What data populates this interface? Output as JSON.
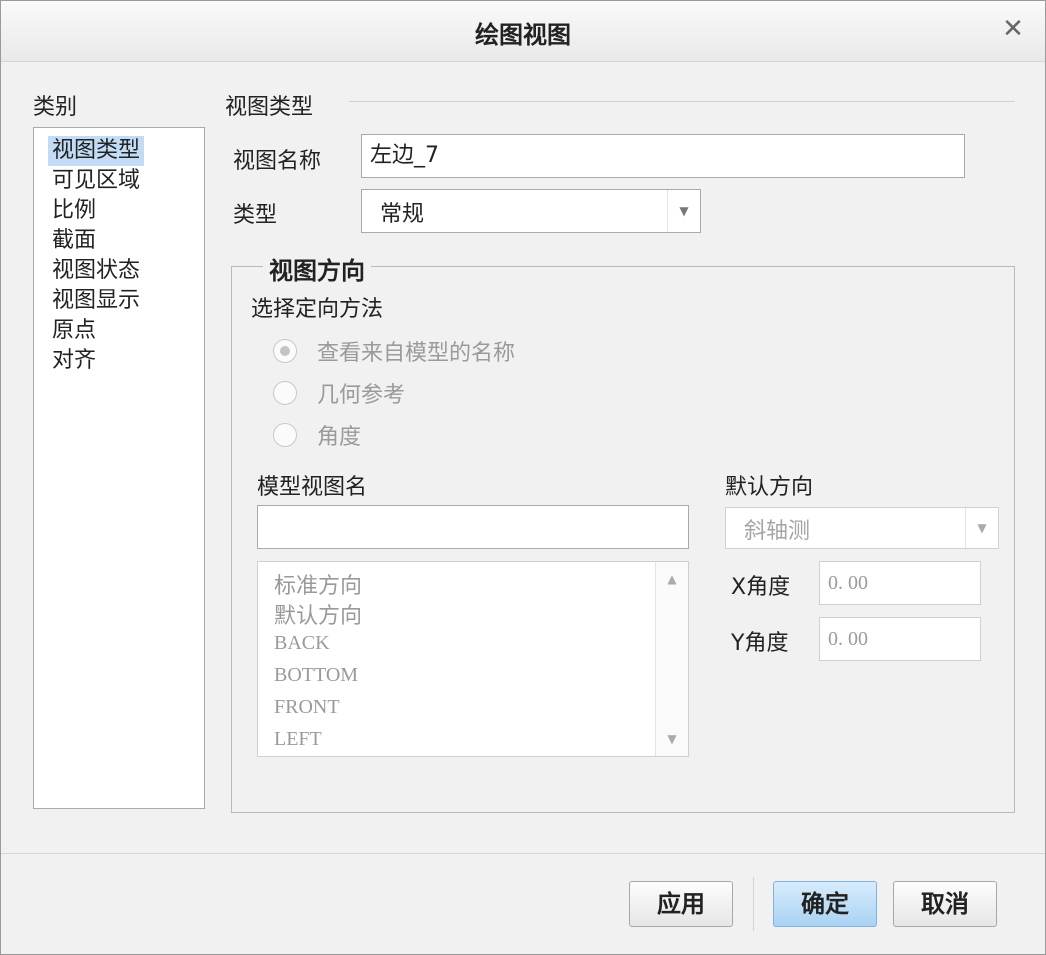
{
  "dialog": {
    "title": "绘图视图",
    "close_glyph": "✕"
  },
  "categories": {
    "heading": "类别",
    "items": [
      {
        "label": "视图类型",
        "selected": true
      },
      {
        "label": "可见区域",
        "selected": false
      },
      {
        "label": "比例",
        "selected": false
      },
      {
        "label": "截面",
        "selected": false
      },
      {
        "label": "视图状态",
        "selected": false
      },
      {
        "label": "视图显示",
        "selected": false
      },
      {
        "label": "原点",
        "selected": false
      },
      {
        "label": "对齐",
        "selected": false
      }
    ]
  },
  "view_type_section": {
    "heading": "视图类型",
    "view_name_label": "视图名称",
    "view_name_value": "左边_7",
    "type_label": "类型",
    "type_value": "常规"
  },
  "view_orientation": {
    "group_title": "视图方向",
    "method_label": "选择定向方法",
    "options": [
      {
        "label": "查看来自模型的名称",
        "checked": true
      },
      {
        "label": "几何参考",
        "checked": false
      },
      {
        "label": "角度",
        "checked": false
      }
    ],
    "model_view_name_label": "模型视图名",
    "model_view_name_value": "",
    "model_views": [
      "标准方向",
      "默认方向",
      "BACK",
      "BOTTOM",
      "FRONT",
      "LEFT"
    ],
    "default_orientation_label": "默认方向",
    "default_orientation_value": "斜轴测",
    "x_angle_label": "X角度",
    "x_angle_value": "0. 00",
    "y_angle_label": "Y角度",
    "y_angle_value": "0. 00"
  },
  "footer": {
    "apply_label": "应用",
    "ok_label": "确定",
    "cancel_label": "取消"
  },
  "colors": {
    "selection": "#c3dcf6",
    "primary_button": "#a9d2f3",
    "disabled_text": "#9a9a9a"
  }
}
